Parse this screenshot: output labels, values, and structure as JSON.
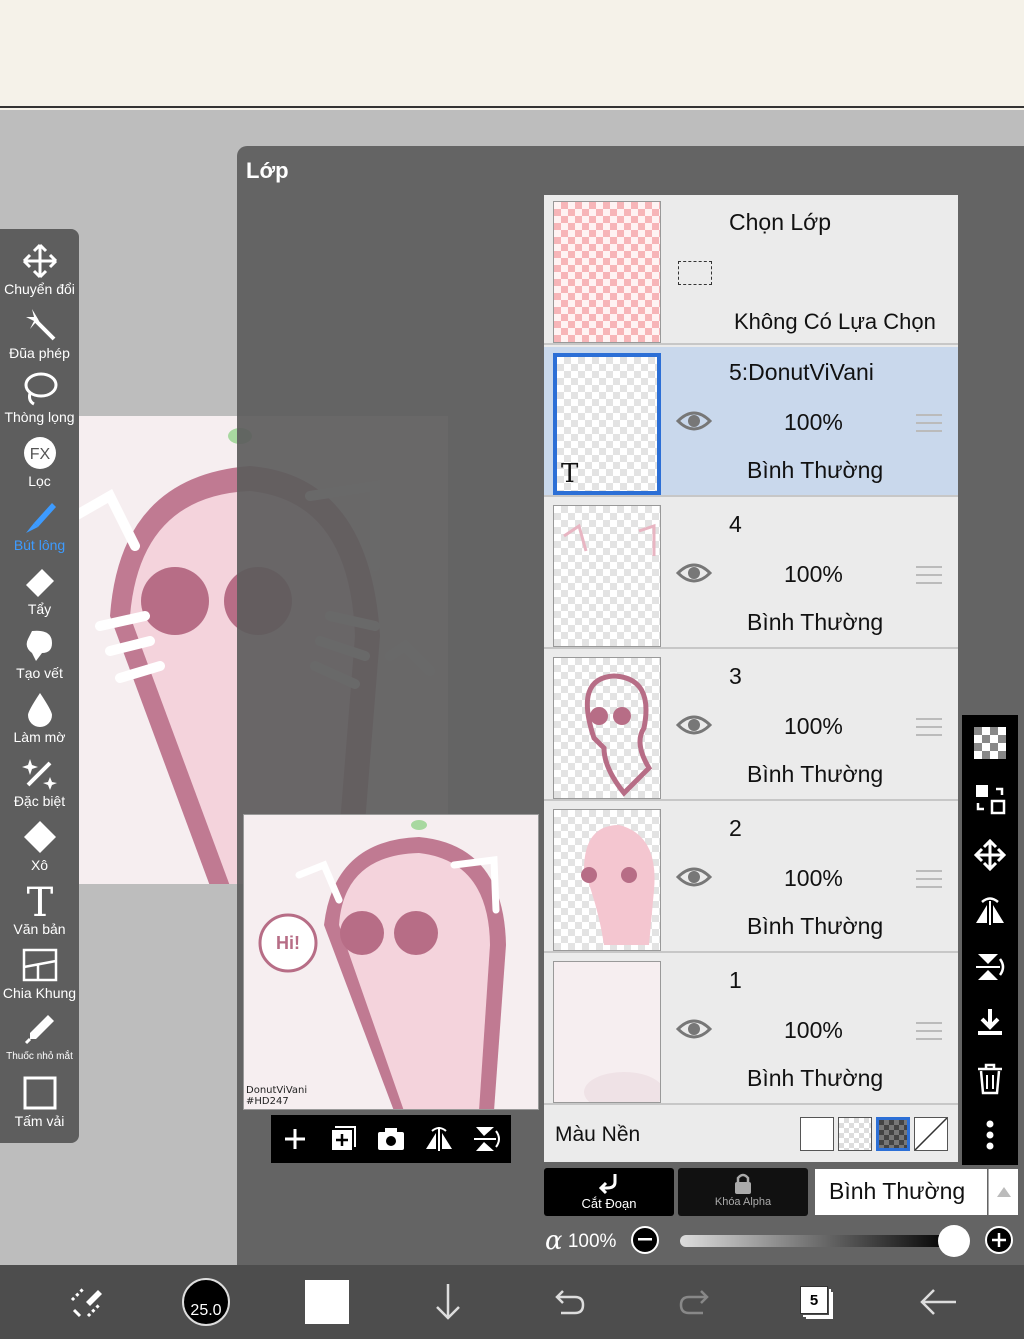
{
  "panel": {
    "title": "Lớp"
  },
  "toolbar": {
    "items": [
      {
        "label": "Chuyển đổi",
        "icon": "move-icon"
      },
      {
        "label": "Đũa phép",
        "icon": "magic-wand-icon"
      },
      {
        "label": "Thòng lọng",
        "icon": "lasso-icon"
      },
      {
        "label": "Lọc",
        "icon": "filter-fx-icon"
      },
      {
        "label": "Bút lông",
        "icon": "brush-icon",
        "active": true
      },
      {
        "label": "Tẩy",
        "icon": "eraser-icon"
      },
      {
        "label": "Tạo vết",
        "icon": "smudge-icon"
      },
      {
        "label": "Làm mờ",
        "icon": "blur-icon"
      },
      {
        "label": "Đặc biệt",
        "icon": "special-icon"
      },
      {
        "label": "Xô",
        "icon": "bucket-icon"
      },
      {
        "label": "Văn bản",
        "icon": "text-icon"
      },
      {
        "label": "Chia Khung",
        "icon": "frame-divider-icon"
      },
      {
        "label": "Thuốc nhỏ mắt",
        "icon": "eyedropper-icon"
      },
      {
        "label": "Tấm vải",
        "icon": "canvas-icon"
      }
    ]
  },
  "preview": {
    "credit_line1": "DonutViVani",
    "credit_line2": "#HD247"
  },
  "selection_layer": {
    "title": "Chọn Lớp",
    "subtitle": "Không Có Lựa Chọn"
  },
  "layers": [
    {
      "name": "5:DonutViVani",
      "opacity": "100%",
      "blend": "Bình Thường",
      "selected": true,
      "text_marker": "T"
    },
    {
      "name": "4",
      "opacity": "100%",
      "blend": "Bình Thường"
    },
    {
      "name": "3",
      "opacity": "100%",
      "blend": "Bình Thường"
    },
    {
      "name": "2",
      "opacity": "100%",
      "blend": "Bình Thường"
    },
    {
      "name": "1",
      "opacity": "100%",
      "blend": "Bình Thường"
    }
  ],
  "background": {
    "label": "Màu Nền"
  },
  "blend_controls": {
    "clip_label": "Cắt Đoạn",
    "alpha_lock_label": "Khóa Alpha",
    "blend_mode": "Bình Thường"
  },
  "alpha": {
    "symbol": "α",
    "value": "100%",
    "level": 1.0
  },
  "bottom": {
    "brush_size": "25.0",
    "layer_count": "5"
  },
  "colors": {
    "accent": "#2c6fd6",
    "selected_row": "#c9d8ec",
    "active_tool": "#3d9bff",
    "art_pink": "#c07a92"
  }
}
